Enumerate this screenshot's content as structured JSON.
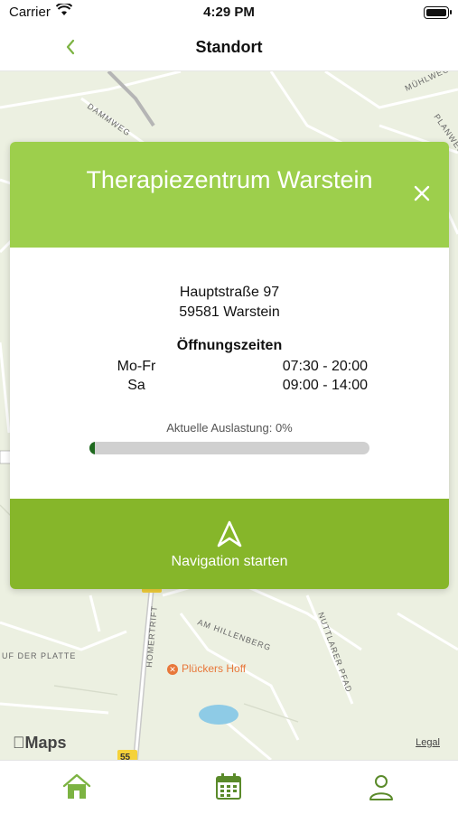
{
  "status_bar": {
    "carrier": "Carrier",
    "time": "4:29 PM"
  },
  "nav_bar": {
    "title": "Standort"
  },
  "map": {
    "brand": "Maps",
    "legal": "Legal",
    "poi": "Plückers Hoff",
    "street_labels": [
      "DAMMWEG",
      "MÜHLWEG",
      "PLANWEG",
      "AM HILLENBERG",
      "NUTTLARER PFAD",
      "HOMERTRIFT",
      "UF DER PLATTE"
    ],
    "road_badge": "55"
  },
  "card": {
    "title": "Therapiezentrum Warstein",
    "address_line1": "Hauptstraße 97",
    "address_line2": "59581 Warstein",
    "hours_title": "Öffnungszeiten",
    "hours": [
      {
        "day": "Mo-Fr",
        "time": "07:30 - 20:00"
      },
      {
        "day": "Sa",
        "time": "09:00 - 14:00"
      }
    ],
    "load_label": "Aktuelle Auslastung: 0%",
    "load_percent": 0,
    "nav_button_label": "Navigation starten"
  },
  "colors": {
    "header": "#9dcf4c",
    "nav_button": "#86b62a",
    "accent": "#7cb342",
    "progress_fill": "#1f6a1f"
  },
  "tab_bar": {
    "items": [
      "home-icon",
      "calendar-icon",
      "profile-icon"
    ]
  }
}
